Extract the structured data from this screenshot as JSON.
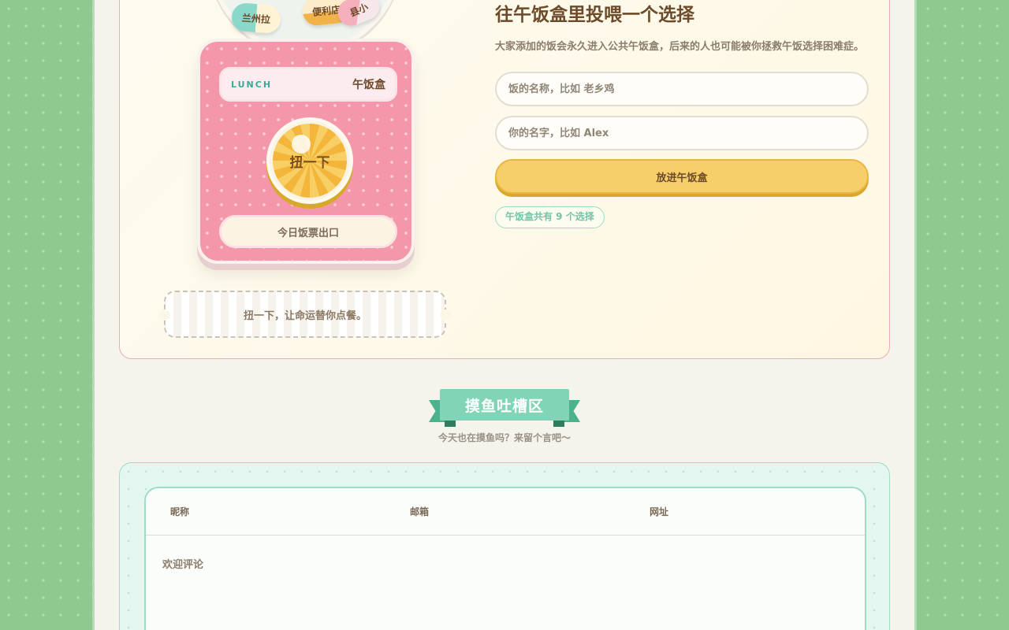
{
  "machine": {
    "capsules": [
      "兰州拉",
      "便利店",
      "县小"
    ],
    "label_tag": "LUNCH",
    "label_name": "午饭盒",
    "knob_label": "扭一下",
    "exit_label": "今日饭票出口",
    "ticket_text": "扭一下，让命运替你点餐。"
  },
  "add_form": {
    "title": "往午饭盒里投喂一个选择",
    "description": "大家添加的饭会永久进入公共午饭盒，后来的人也可能被你拯救午饭选择困难症。",
    "food_placeholder": "饭的名称，比如 老乡鸡",
    "name_placeholder": "你的名字，比如 Alex",
    "submit_label": "放进午饭盒",
    "count_text": "午饭盒共有 9 个选择"
  },
  "comments": {
    "ribbon_title": "摸鱼吐槽区",
    "subtitle": "今天也在摸鱼吗？来留个言吧～",
    "nickname_placeholder": "昵称",
    "email_placeholder": "邮箱",
    "website_placeholder": "网址",
    "comment_placeholder": "欢迎评论"
  },
  "colors": {
    "background_green": "#8fc990",
    "machine_pink": "#f597aa",
    "accent_yellow": "#f7cf6a",
    "accent_mint": "#82d4b6",
    "text_brown": "#6d4b2a"
  }
}
